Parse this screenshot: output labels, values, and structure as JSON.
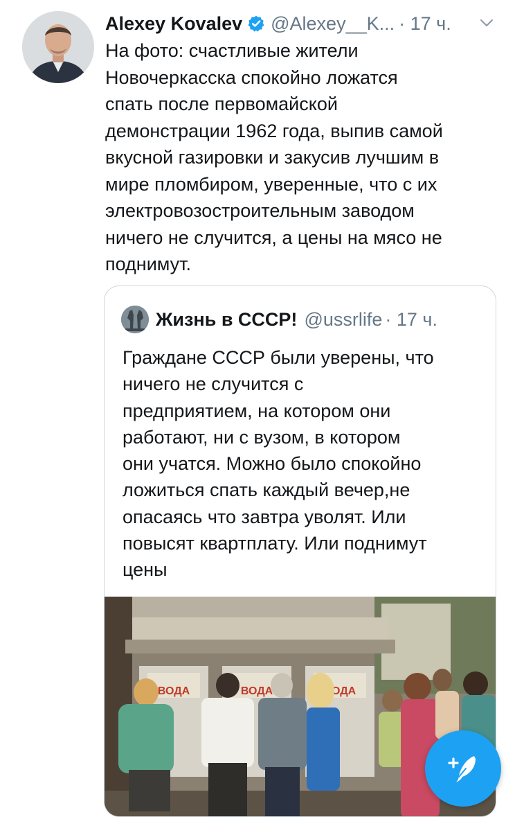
{
  "tweet": {
    "author_name": "Alexey Kovalev",
    "verified_icon": "verified-badge-icon",
    "handle": "@Alexey__K...",
    "time": "· 17 ч.",
    "text": "На фото: счастливые жители\nНовочеркасска спокойно ложатся\nспать после первомайской\nдемонстрации 1962 года, выпив самой\nвкусной газировки и закусив лучшим в\nмире пломбиром, уверенные, что с их\nэлектровозостроительным заводом\nничего не случится, а цены на мясо не\nподнимут."
  },
  "quoted_tweet": {
    "author_name": "Жизнь в СССР!",
    "handle": "@ussrlife",
    "time": "· 17 ч.",
    "text": "Граждане СССР были уверены, что\nничего не случится с\nпредприятием, на котором они\nработают, ни с вузом, в котором\nони учатся. Можно было спокойно\nложиться спать каждый вечер,не\nопасаясь что завтра уволят. Или\nповысят квартплату. Или поднимут\nцены",
    "photo": {
      "sign_1": "ВОДА",
      "sign_2": "ВОДА",
      "sign_3": "ВОДА"
    }
  },
  "fab": {
    "icon": "compose-tweet-icon"
  },
  "colors": {
    "accent": "#1da1f2",
    "text": "#14171a",
    "secondary": "#657786",
    "border": "#ccd6dd"
  }
}
